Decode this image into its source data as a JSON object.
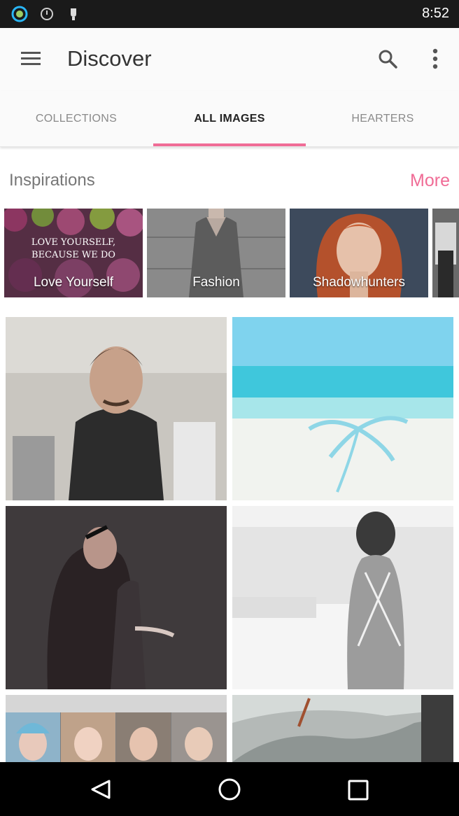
{
  "status_bar": {
    "time": "8:52",
    "icons": [
      "circle-app-icon",
      "alarm-icon",
      "bulb-icon"
    ]
  },
  "app_bar": {
    "title": "Discover",
    "menu_icon": "hamburger-menu-icon",
    "search_icon": "search-icon",
    "overflow_icon": "more-vertical-icon"
  },
  "tabs": [
    {
      "label": "COLLECTIONS",
      "active": false
    },
    {
      "label": "ALL IMAGES",
      "active": true
    },
    {
      "label": "HEARTERS",
      "active": false
    }
  ],
  "accent_color": "#f06c96",
  "inspirations": {
    "label": "Inspirations",
    "more_label": "More",
    "collections": [
      {
        "name": "Love Yourself",
        "overlay": "LOVE YOURSELF, BECAUSE WE DO"
      },
      {
        "name": "Fashion"
      },
      {
        "name": "Shadowhunters"
      },
      {
        "name": ""
      }
    ]
  },
  "grid_images": [
    {
      "subject": "man-in-leather-jacket"
    },
    {
      "subject": "tropical-beach"
    },
    {
      "subject": "singer-with-microphone"
    },
    {
      "subject": "woman-in-white-room"
    },
    {
      "subject": "group-selfie-collage"
    },
    {
      "subject": "hand-holding-pen"
    }
  ],
  "nav_bar": {
    "back_icon": "back-triangle-icon",
    "home_icon": "home-circle-icon",
    "recents_icon": "recents-square-icon"
  }
}
